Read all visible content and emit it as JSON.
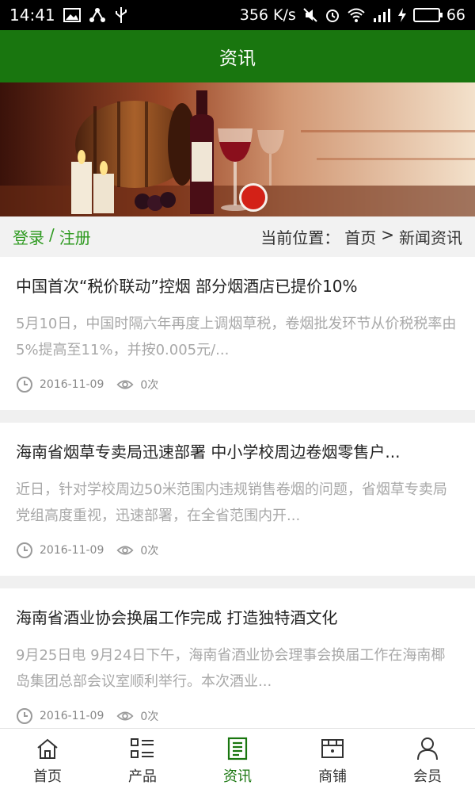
{
  "status_bar": {
    "time": "14:41",
    "speed": "356 K/s",
    "battery": "66"
  },
  "header": {
    "title": "资讯"
  },
  "subnav": {
    "login": "登录",
    "sep": "/",
    "register": "注册",
    "location_label": "当前位置：",
    "crumb_home": "首页",
    "crumb_sep": ">",
    "crumb_current": "新闻资讯"
  },
  "articles": [
    {
      "title": "中国首次“税价联动”控烟 部分烟酒店已提价10%",
      "summary": "5月10日，中国时隔六年再度上调烟草税，卷烟批发环节从价税税率由5%提高至11%，并按0.005元/...",
      "date": "2016-11-09",
      "views": "0次"
    },
    {
      "title": "海南省烟草专卖局迅速部署 中小学校周边卷烟零售户...",
      "summary": "近日，针对学校周边50米范围内违规销售卷烟的问题，省烟草专卖局党组高度重视，迅速部署，在全省范围内开...",
      "date": "2016-11-09",
      "views": "0次"
    },
    {
      "title": "海南省酒业协会换届工作完成 打造独特酒文化",
      "summary": "9月25日电 9月24日下午，海南省酒业协会理事会换届工作在海南椰岛集团总部会议室顺利举行。本次酒业...",
      "date": "2016-11-09",
      "views": "0次"
    }
  ],
  "bottom_nav": {
    "home": "首页",
    "products": "产品",
    "news": "资讯",
    "shop": "商铺",
    "member": "会员",
    "active_color": "#19760f"
  }
}
